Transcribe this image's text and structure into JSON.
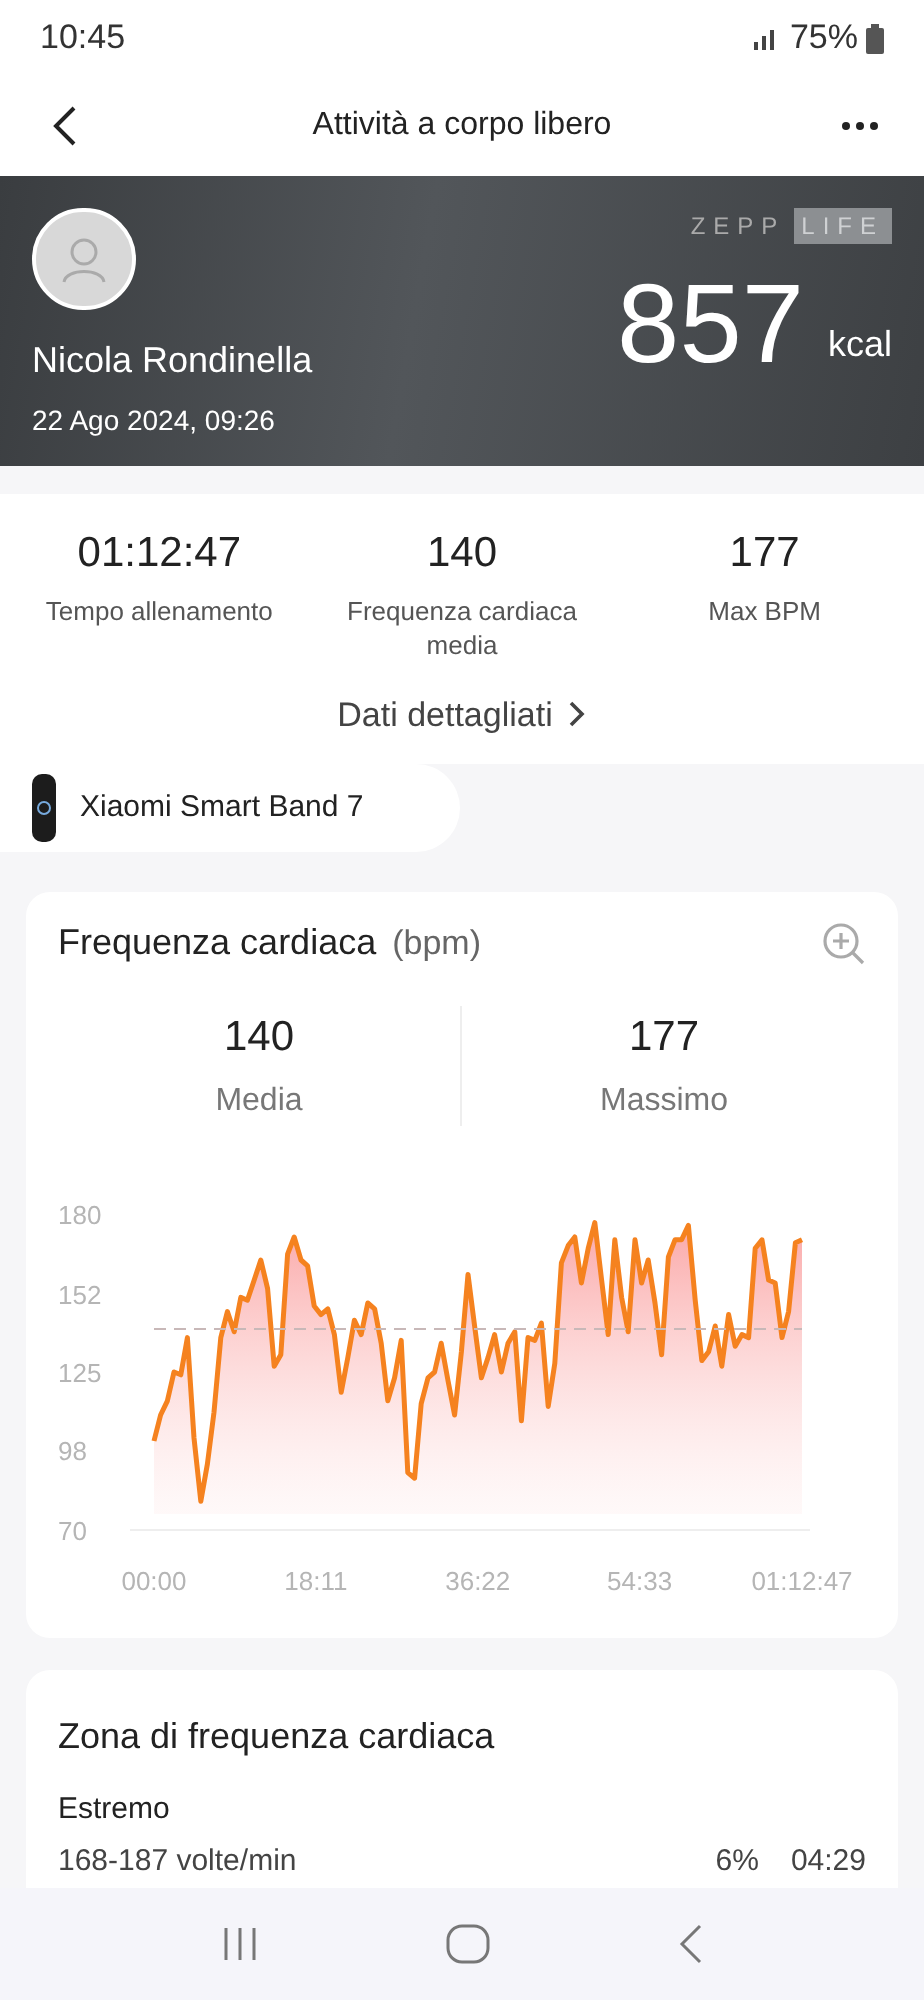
{
  "status_bar": {
    "time": "10:45",
    "battery": "75%"
  },
  "header": {
    "title": "Attività a corpo libero"
  },
  "hero": {
    "brand": [
      "ZEPP",
      "LIFE"
    ],
    "name": "Nicola Rondinella",
    "date": "22 Ago 2024, 09:26",
    "calories": "857",
    "unit": "kcal"
  },
  "summary": [
    {
      "value": "01:12:47",
      "label": "Tempo allenamento"
    },
    {
      "value": "140",
      "label": "Frequenza cardiaca media"
    },
    {
      "value": "177",
      "label": "Max BPM"
    }
  ],
  "details_link": "Dati dettagliati",
  "device": "Xiaomi Smart Band 7",
  "heart_rate": {
    "title": "Frequenza cardiaca",
    "unit": "(bpm)",
    "stats": [
      {
        "value": "140",
        "label": "Media"
      },
      {
        "value": "177",
        "label": "Massimo"
      }
    ],
    "chart_data": {
      "type": "area",
      "xlim": [
        0,
        4367
      ],
      "x": [
        0,
        45,
        90,
        135,
        180,
        225,
        270,
        315,
        360,
        405,
        450,
        495,
        540,
        585,
        630,
        675,
        720,
        765,
        810,
        855,
        900,
        945,
        990,
        1035,
        1080,
        1126,
        1171,
        1216,
        1261,
        1306,
        1351,
        1396,
        1441,
        1486,
        1531,
        1576,
        1621,
        1666,
        1711,
        1756,
        1801,
        1846,
        1891,
        1936,
        1981,
        2026,
        2071,
        2116,
        2161,
        2206,
        2251,
        2296,
        2341,
        2386,
        2431,
        2476,
        2521,
        2566,
        2611,
        2656,
        2701,
        2746,
        2791,
        2836,
        2881,
        2926,
        2971,
        3016,
        3061,
        3106,
        3151,
        3196,
        3241,
        3286,
        3331,
        3376,
        3421,
        3466,
        3511,
        3556,
        3602,
        3647,
        3692,
        3737,
        3782,
        3827,
        3872,
        3917,
        3962,
        4007,
        4052,
        4097,
        4142,
        4187,
        4232,
        4277,
        4322,
        4367
      ],
      "ylim": [
        70,
        180
      ],
      "yticks": [
        70,
        98,
        125,
        152,
        180
      ],
      "xticks": [
        {
          "value": 0,
          "label": "00:00"
        },
        {
          "value": 1091,
          "label": "18:11"
        },
        {
          "value": 2182,
          "label": "36:22"
        },
        {
          "value": 3273,
          "label": "54:33"
        },
        {
          "value": 4367,
          "label": "01:12:47"
        }
      ],
      "series": [
        {
          "color": "#f5821f",
          "values": [
            101,
            110,
            115,
            125,
            124,
            137,
            102,
            80,
            93,
            111,
            137,
            146,
            139,
            151,
            150,
            157,
            164,
            154,
            127,
            131,
            166,
            172,
            164,
            162,
            148,
            145,
            147,
            138,
            118,
            130,
            143,
            138,
            149,
            147,
            135,
            115,
            123,
            136,
            90,
            88,
            114,
            123,
            125,
            135,
            122,
            110,
            132,
            159,
            141,
            123,
            130,
            138,
            125,
            135,
            139,
            108,
            137,
            136,
            142,
            113,
            128,
            163,
            169,
            172,
            156,
            168,
            177,
            157,
            138,
            171,
            151,
            139,
            171,
            156,
            164,
            149,
            131,
            165,
            171,
            171,
            176,
            150,
            129,
            132,
            141,
            127,
            145,
            134,
            138,
            137,
            168,
            171,
            157,
            156,
            137,
            146,
            170,
            171
          ]
        }
      ],
      "ref_lines": [
        {
          "axis": "y",
          "value": 140
        }
      ]
    }
  },
  "zones": {
    "title": "Zona di frequenza cardiaca",
    "items": [
      {
        "name": "Estremo",
        "range": "168-187 volte/min",
        "share": "6%",
        "time": "04:29"
      }
    ]
  }
}
